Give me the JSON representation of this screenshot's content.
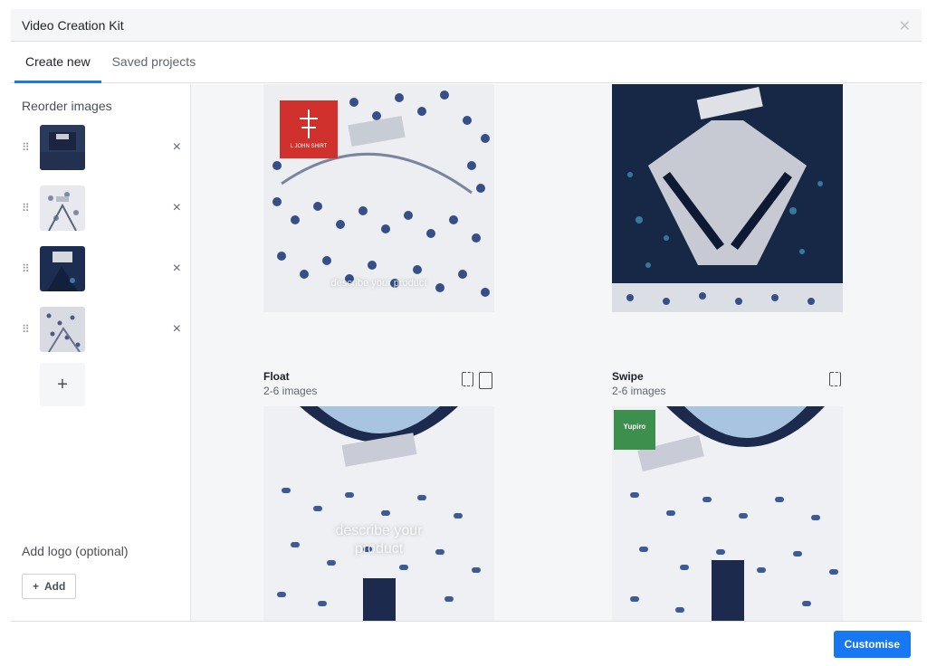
{
  "window": {
    "title": "Video Creation Kit",
    "close_icon": "close-icon"
  },
  "tabs": [
    {
      "label": "Create new",
      "active": true
    },
    {
      "label": "Saved projects",
      "active": false
    }
  ],
  "sidebar": {
    "reorder_title": "Reorder images",
    "images": [
      {
        "thumb": "dark-shirt-thumbnail",
        "remove": "×"
      },
      {
        "thumb": "white-floral-shirt-thumbnail",
        "remove": "×"
      },
      {
        "thumb": "navy-shirt-thumbnail",
        "remove": "×"
      },
      {
        "thumb": "dotted-shirt-thumbnail",
        "remove": "×"
      }
    ],
    "add_image_label": "+",
    "logo_title": "Add logo (optional)",
    "add_logo_label": "Add"
  },
  "templates": [
    {
      "name": "",
      "sub": "",
      "overlay": "describe your product"
    },
    {
      "name": "",
      "sub": "",
      "overlay": ""
    },
    {
      "name": "Float",
      "sub": "2-6 images",
      "overlay": "describe your product"
    },
    {
      "name": "Swipe",
      "sub": "2-6 images",
      "overlay": ""
    }
  ],
  "logo_badges": {
    "first": "L JOHN SHIRT",
    "second": "Yupiro"
  },
  "footer": {
    "primary_label": "Customise"
  },
  "colors": {
    "accent": "#1877f2",
    "panel": "#f5f6f7"
  }
}
